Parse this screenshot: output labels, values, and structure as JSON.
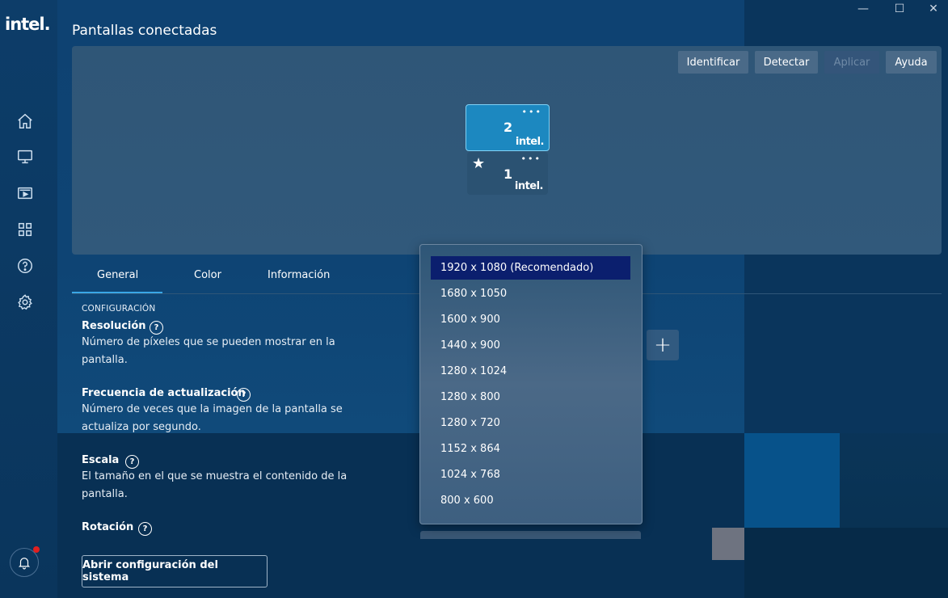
{
  "app": {
    "logo": "intel.",
    "page_title": "Pantallas conectadas"
  },
  "window_controls": [
    "—",
    "☐",
    "✕"
  ],
  "sidebar": {
    "items": [
      {
        "icon": "home-icon"
      },
      {
        "icon": "display-icon"
      },
      {
        "icon": "video-icon"
      },
      {
        "icon": "apps-grid-icon"
      },
      {
        "icon": "help-icon"
      },
      {
        "icon": "gear-icon"
      }
    ],
    "notification_icon": "bell-icon"
  },
  "toolbar": {
    "identify": "Identificar",
    "detect": "Detectar",
    "apply": "Aplicar",
    "help": "Ayuda"
  },
  "monitors": [
    {
      "number": "2",
      "brand": "intel.",
      "menu": "•••",
      "selected": true
    },
    {
      "number": "1",
      "brand": "intel.",
      "menu": "•••",
      "primary_star": "★"
    }
  ],
  "tabs": [
    {
      "label": "General",
      "active": true
    },
    {
      "label": "Color"
    },
    {
      "label": "Información"
    }
  ],
  "settings": {
    "section_label": "CONFIGURACIÓN",
    "resolution": {
      "title": "Resolución",
      "desc": "Número de píxeles que se pueden mostrar en la pantalla."
    },
    "refresh": {
      "title": "Frecuencia de actualización",
      "desc": "Número de veces que la imagen de la pantalla se actualiza por segundo."
    },
    "scale": {
      "title": "Escala",
      "desc": "El tamaño en el que se muestra el contenido de la pantalla."
    },
    "rotation": {
      "title": "Rotación"
    },
    "help_glyph": "?",
    "system_button": "Abrir configuración del sistema",
    "plus_glyph": "+"
  },
  "resolution_dropdown": {
    "options": [
      "1920 x 1080 (Recomendado)",
      "1680 x 1050",
      "1600 x 900",
      "1440 x 900",
      "1280 x 1024",
      "1280 x 800",
      "1280 x 720",
      "1152 x 864",
      "1024 x 768",
      "800 x 600"
    ],
    "selected_index": 0
  }
}
